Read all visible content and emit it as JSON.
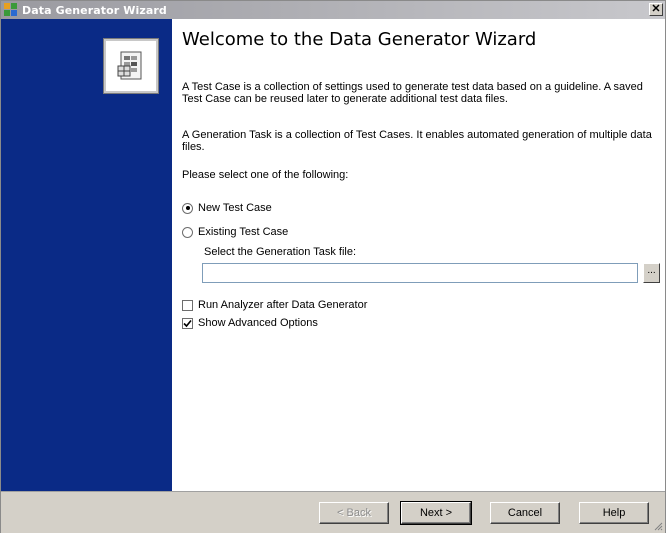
{
  "window": {
    "title": "Data Generator Wizard",
    "close_glyph": "✕",
    "icon": "wizard-app-icon"
  },
  "sidebar": {
    "background": "#0a2a86",
    "image_icon": "document-grid-icon"
  },
  "main": {
    "heading": "Welcome to the Data Generator Wizard",
    "paragraph_test_case": "A Test Case is a collection of settings used to generate test data based on a guideline.  A saved Test Case can be reused later to generate additional test data files.",
    "paragraph_generation_task": "A Generation Task is a collection of Test Cases.  It enables automated generation of multiple data files.",
    "select_prompt": "Please select one of the following:",
    "options": {
      "new_test_case": {
        "label": "New Test Case",
        "selected": true
      },
      "existing_test_case": {
        "label": "Existing Test Case",
        "selected": false
      }
    },
    "file_label": "Select the Generation Task file:",
    "file_value": "",
    "browse_label": "...",
    "checkboxes": {
      "run_analyzer": {
        "label": "Run Analyzer after Data Generator",
        "checked": false
      },
      "show_advanced": {
        "label": "Show Advanced Options",
        "checked": true
      }
    }
  },
  "buttons": {
    "back": "< Back",
    "next": "Next >",
    "cancel": "Cancel",
    "help": "Help"
  }
}
